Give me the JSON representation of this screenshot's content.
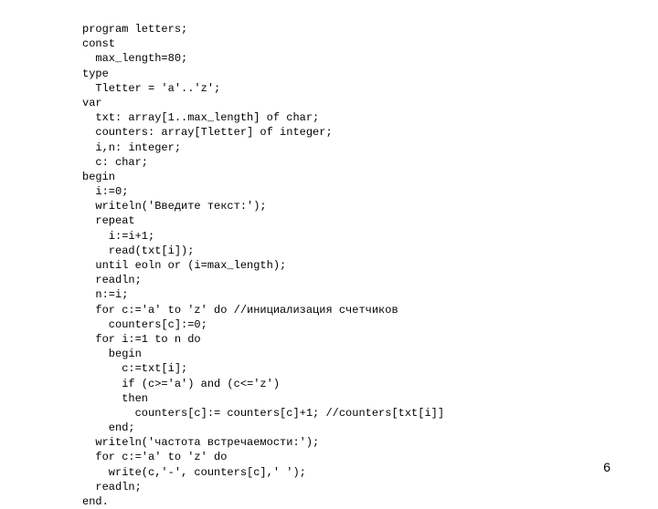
{
  "page_number": "6",
  "code": {
    "l01": "program letters;",
    "l02": "const",
    "l03": "  max_length=80;",
    "l04": "type",
    "l05": "  Tletter = 'a'..'z';",
    "l06": "var",
    "l07": "  txt: array[1..max_length] of char;",
    "l08": "  counters: array[Tletter] of integer;",
    "l09": "  i,n: integer;",
    "l10": "  c: char;",
    "l11": "begin",
    "l12": "  i:=0;",
    "l13": "  writeln('Введите текст:');",
    "l14": "  repeat",
    "l15": "    i:=i+1;",
    "l16": "    read(txt[i]);",
    "l17": "  until eoln or (i=max_length);",
    "l18": "  readln;",
    "l19": "  n:=i;",
    "l20": "  for c:='a' to 'z' do //инициализация счетчиков",
    "l21": "    counters[c]:=0;",
    "l22": "  for i:=1 to n do",
    "l23": "    begin",
    "l24": "      c:=txt[i];",
    "l25": "      if (c>='a') and (c<='z')",
    "l26": "      then",
    "l27": "        counters[c]:= counters[c]+1; //counters[txt[i]]",
    "l28": "    end;",
    "l29": "  writeln('частота встречаемости:');",
    "l30": "  for c:='a' to 'z' do",
    "l31": "    write(c,'-', counters[c],' ');",
    "l32": "  readln;",
    "l33": "end."
  }
}
